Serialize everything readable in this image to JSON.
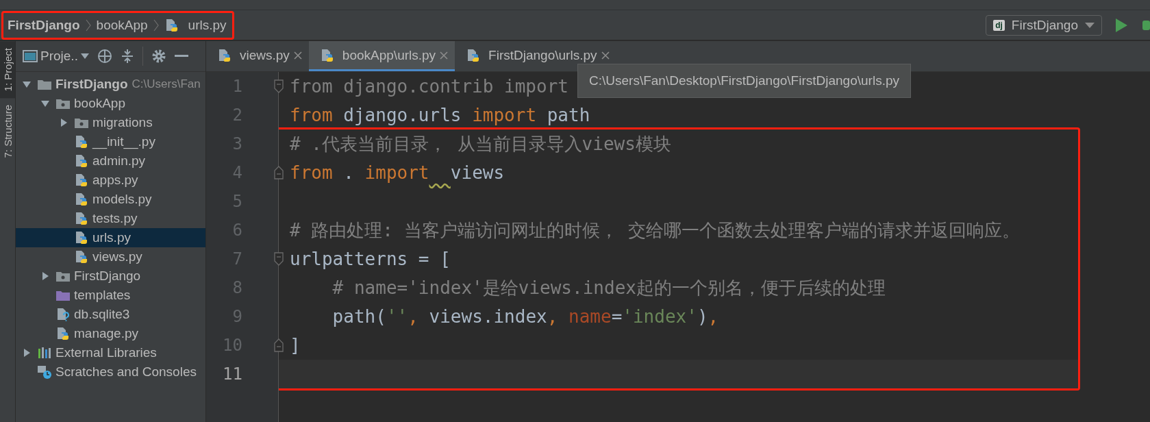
{
  "breadcrumb": {
    "annotation_frame": {
      "items": [
        {
          "label": "FirstDjango",
          "kind": "project"
        },
        {
          "label": "bookApp",
          "kind": "folder"
        },
        {
          "label": "urls.py",
          "kind": "python"
        }
      ]
    }
  },
  "run_config": {
    "icon_text": "dj",
    "label": "FirstDjango"
  },
  "side_tabs": [
    {
      "label": "1: Project",
      "selected": true
    },
    {
      "label": "7: Structure",
      "selected": false
    }
  ],
  "project_panel": {
    "title": "Proje..",
    "tree": [
      {
        "label": "FirstDjango",
        "kind": "folder",
        "hint": "C:\\Users\\Fan",
        "expanded": true,
        "selected": false,
        "children": [
          {
            "label": "bookApp",
            "kind": "package",
            "expanded": true,
            "selected": false,
            "children": [
              {
                "label": "migrations",
                "kind": "package",
                "expanded": false,
                "selected": false
              },
              {
                "label": "__init__.py",
                "kind": "python",
                "selected": false
              },
              {
                "label": "admin.py",
                "kind": "python",
                "selected": false
              },
              {
                "label": "apps.py",
                "kind": "python",
                "selected": false
              },
              {
                "label": "models.py",
                "kind": "python",
                "selected": false
              },
              {
                "label": "tests.py",
                "kind": "python",
                "selected": false
              },
              {
                "label": "urls.py",
                "kind": "python",
                "selected": true
              },
              {
                "label": "views.py",
                "kind": "python",
                "selected": false
              }
            ]
          },
          {
            "label": "FirstDjango",
            "kind": "package",
            "expanded": false,
            "selected": false
          },
          {
            "label": "templates",
            "kind": "templates",
            "selected": false
          },
          {
            "label": "db.sqlite3",
            "kind": "unknown",
            "selected": false
          },
          {
            "label": "manage.py",
            "kind": "python",
            "selected": false
          }
        ]
      },
      {
        "label": "External Libraries",
        "kind": "libraries",
        "expanded": false,
        "selected": false
      },
      {
        "label": "Scratches and Consoles",
        "kind": "scratches",
        "selected": false
      }
    ]
  },
  "tabs": [
    {
      "label": "views.py",
      "selected": false
    },
    {
      "label": "bookApp\\urls.py",
      "selected": true
    },
    {
      "label": "FirstDjango\\urls.py",
      "selected": false
    }
  ],
  "tooltip": "C:\\Users\\Fan\\Desktop\\FirstDjango\\FirstDjango\\urls.py",
  "editor": {
    "lines": [
      {
        "number": "1",
        "kind": "fold-start",
        "current": false,
        "tokens": [
          {
            "text": "from django.contrib import",
            "kind": "unused"
          }
        ]
      },
      {
        "number": "2",
        "kind": "plain",
        "current": false,
        "tokens": [
          {
            "text": "from",
            "kind": "keyword"
          },
          {
            "text": " django.urls ",
            "kind": "plain"
          },
          {
            "text": "import",
            "kind": "keyword"
          },
          {
            "text": " path",
            "kind": "plain"
          }
        ]
      }
    ],
    "annotation_frame": {
      "lines": [
        {
          "number": "3",
          "kind": "plain",
          "current": false,
          "tokens": [
            {
              "text": "# .代表当前目录， 从当前目录导入views模块",
              "kind": "comment"
            }
          ]
        },
        {
          "number": "4",
          "kind": "fold-end",
          "current": false,
          "tokens": [
            {
              "text": "from",
              "kind": "keyword"
            },
            {
              "text": " . ",
              "kind": "plain"
            },
            {
              "text": "import",
              "kind": "keyword"
            },
            {
              "text": "  views",
              "kind": "warned"
            }
          ]
        },
        {
          "number": "5",
          "kind": "plain",
          "current": false
        },
        {
          "number": "6",
          "kind": "plain",
          "current": false,
          "tokens": [
            {
              "text": "# 路由处理: 当客户端访问网址的时候， 交给哪一个函数去处理客户端的请求并返回响应。",
              "kind": "comment"
            }
          ]
        },
        {
          "number": "7",
          "kind": "fold-start",
          "current": false,
          "tokens": [
            {
              "text": "urlpatterns = [",
              "kind": "plain"
            }
          ]
        },
        {
          "number": "8",
          "kind": "plain",
          "current": false,
          "tokens": [
            {
              "text": "    # name='index'是给views.index起的一个别名，便于后续的处理",
              "kind": "comment"
            }
          ]
        },
        {
          "number": "9",
          "kind": "plain",
          "current": false,
          "tokens": [
            {
              "text": "    path(",
              "kind": "plain"
            },
            {
              "text": "''",
              "kind": "string"
            },
            {
              "text": ",",
              "kind": "keyword"
            },
            {
              "text": " views.index",
              "kind": "plain"
            },
            {
              "text": ", ",
              "kind": "keyword"
            },
            {
              "text": "name",
              "kind": "param"
            },
            {
              "text": "=",
              "kind": "plain"
            },
            {
              "text": "'index'",
              "kind": "string"
            },
            {
              "text": ")",
              "kind": "plain"
            },
            {
              "text": ",",
              "kind": "keyword"
            }
          ]
        },
        {
          "number": "10",
          "kind": "fold-end",
          "current": false,
          "tokens": [
            {
              "text": "]",
              "kind": "plain"
            }
          ]
        },
        {
          "number": "11",
          "kind": "plain",
          "current": true
        }
      ]
    }
  }
}
